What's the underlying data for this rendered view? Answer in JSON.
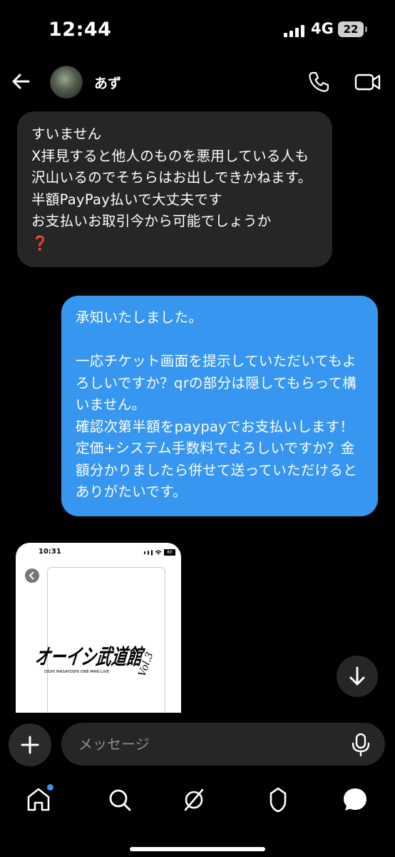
{
  "status_bar": {
    "time": "12:44",
    "network": "4G",
    "battery": "22"
  },
  "header": {
    "contact_name": "あず",
    "icons": [
      "back-arrow-icon",
      "phone-icon",
      "video-camera-icon"
    ]
  },
  "messages": [
    {
      "direction": "incoming",
      "text": "すいません\nX拝見すると他人のものを悪用している人も沢山いるのでそちらはお出しできかねます。\n半額PayPay払いで大丈夫です\nお支払いお取引今から可能でしょうか\n❓"
    },
    {
      "direction": "outgoing",
      "text": "承知いたしました。\n\n一応チケット画面を提示していただいてもよろしいですか？qrの部分は隠してもらって構いません。\n確認次第半額をpaypayでお支払いします！\n定価+システム手数料でよろしいですか？金額分かりましたら併せて送っていただけるとありがたいです。"
    },
    {
      "direction": "incoming",
      "type": "image",
      "image": {
        "status_time": "10:31",
        "status_battery": "80",
        "logo_text": "オーイシ武道館",
        "logo_sub": "Vol.3",
        "logo_caption": "OISHI MASAYOSHI ONE-MAN LIVE"
      }
    }
  ],
  "composer": {
    "placeholder": "メッセージ"
  },
  "bottom_nav": {
    "items": [
      "home-icon",
      "search-icon",
      "explore-icon",
      "reels-icon",
      "messages-icon"
    ],
    "home_badge_color": "#3797f0"
  },
  "colors": {
    "background": "#000000",
    "incoming_bubble": "#262626",
    "outgoing_bubble": "#3797f0"
  }
}
